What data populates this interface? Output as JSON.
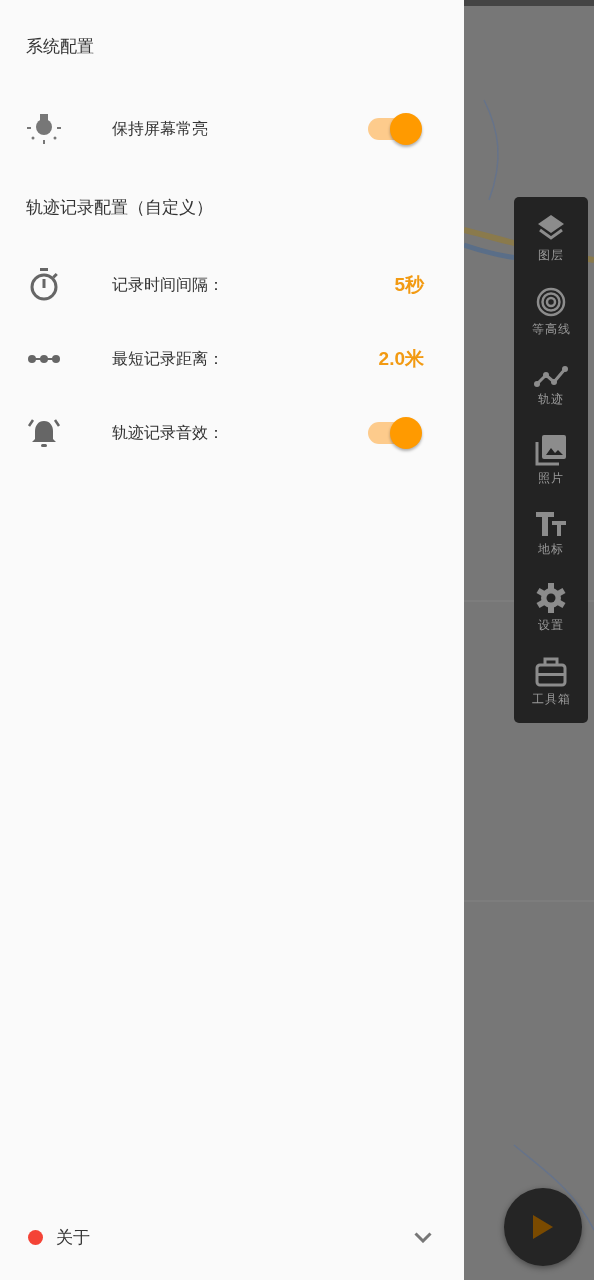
{
  "drawer": {
    "sections": [
      {
        "title": "系统配置",
        "rows": [
          {
            "kind": "switch",
            "label": "保持屏幕常亮",
            "on": true
          }
        ]
      },
      {
        "title": "轨迹记录配置（自定义）",
        "rows": [
          {
            "kind": "value",
            "label": "记录时间间隔：",
            "value": "5秒"
          },
          {
            "kind": "value",
            "label": "最短记录距离：",
            "value": "2.0米"
          },
          {
            "kind": "switch",
            "label": "轨迹记录音效：",
            "on": true
          }
        ]
      }
    ],
    "footer": {
      "label": "关于",
      "unread": true
    }
  },
  "map": {
    "kind": "picture",
    "toolbar": [
      {
        "label": "图层"
      },
      {
        "label": "等高线"
      },
      {
        "label": "轨迹"
      },
      {
        "label": "照片"
      },
      {
        "label": "地标"
      },
      {
        "label": "设置"
      },
      {
        "label": "工具箱"
      }
    ]
  }
}
